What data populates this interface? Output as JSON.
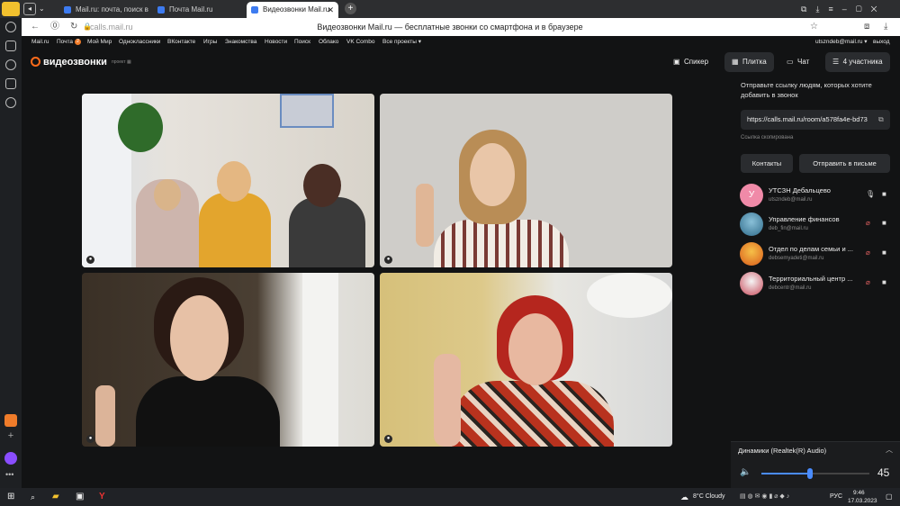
{
  "browser": {
    "tabs": [
      {
        "label": "Mail.ru: почта, поиск в ин"
      },
      {
        "label": "Почта Mail.ru"
      },
      {
        "label": "Видеозвонки Mail.ru"
      }
    ],
    "page_title": "Видеозвонки Mail.ru — бесплатные звонки со смартфона и в браузере",
    "url": "calls.mail.ru",
    "new_tab": "+"
  },
  "mail_nav": {
    "items": [
      "Mail.ru",
      "Почта",
      "Мой Мир",
      "Одноклассники",
      "ВКонтакте",
      "Игры",
      "Знакомства",
      "Новости",
      "Поиск",
      "Облако",
      "VK Combo",
      "Все проекты ▾"
    ],
    "mail_badge": "2",
    "account": "utszndeb@mail.ru ▾",
    "logout": "выход"
  },
  "header": {
    "logo": "видеозвонки",
    "project": "проект ▦",
    "views": [
      "Спикер",
      "Плитка",
      "Чат"
    ],
    "participants_btn": "4 участника"
  },
  "invite": {
    "text": "Отправьте ссылку людям, которых хотите добавить в звонок",
    "link": "https://calls.mail.ru/room/a578fa4e-bd73",
    "copied": "Ссылка скопирована",
    "contacts_btn": "Контакты",
    "send_btn": "Отправить в письме"
  },
  "participants": [
    {
      "name": "УТСЗН Дебальцево",
      "email": "utszndeb@mail.ru",
      "avatar": "У",
      "color": "#f08aa8"
    },
    {
      "name": "Управление финансов",
      "email": "deb_fin@mail.ru",
      "avatar": "",
      "color": "#6a9bb5"
    },
    {
      "name": "Отдел по делам семьи и ...",
      "email": "debsemyadeti@mail.ru",
      "avatar": "",
      "color": "#e8862a"
    },
    {
      "name": "Территориальный центр ...",
      "email": "debcentr@mail.ru",
      "avatar": "",
      "color": "#c84a5a"
    }
  ],
  "audio": {
    "device": "Динамики (Realtek(R) Audio)",
    "volume": "45",
    "volume_level": 0.45
  },
  "taskbar": {
    "weather": "8°C  Cloudy",
    "lang": "РУС",
    "time": "9:46",
    "date": "17.03.2023"
  }
}
